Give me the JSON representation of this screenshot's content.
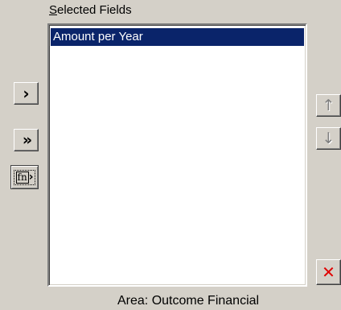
{
  "selected_fields": {
    "label_mnemonic": "S",
    "label_rest": "elected Fields",
    "items": [
      {
        "label": "Amount per Year",
        "selected": true
      }
    ]
  },
  "buttons": {
    "add_glyph": "›",
    "add_all_glyph": "»",
    "function_glyph": "fn",
    "function_arrow_glyph": "›",
    "move_up_glyph": "↑",
    "move_down_glyph": "↓",
    "delete_glyph": "✕",
    "delete_color": "#e00000"
  },
  "area_label": "Area: Outcome Financial",
  "colors": {
    "dialog_background": "#d4d0c8",
    "selection_background": "#0a246a",
    "selection_text": "#ffffff"
  }
}
